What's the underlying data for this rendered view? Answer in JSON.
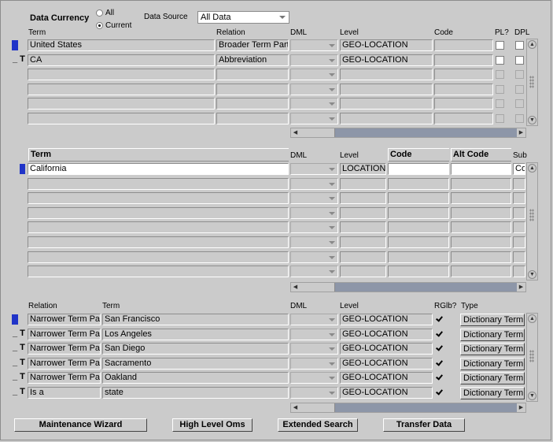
{
  "filters": {
    "data_currency_label": "Data Currency",
    "currency_all": "All",
    "currency_current": "Current",
    "data_source_label": "Data Source",
    "data_source_value": "All Data"
  },
  "block1": {
    "headers": {
      "term": "Term",
      "relation": "Relation",
      "dml": "DML",
      "level": "Level",
      "code": "Code",
      "pl": "PL?",
      "dpl": "DPL"
    },
    "rows": [
      {
        "flag": "",
        "term": "United States",
        "relation": "Broader Term Parti",
        "level": "GEO-LOCATION"
      },
      {
        "flag": "_ T",
        "term": "CA",
        "relation": "Abbreviation",
        "level": "GEO-LOCATION"
      }
    ]
  },
  "block2": {
    "headers": {
      "term": "Term",
      "dml": "DML",
      "level": "Level",
      "code": "Code",
      "alt_code": "Alt Code",
      "sub": "Sub"
    },
    "rows": [
      {
        "term": "California",
        "level": "LOCATION",
        "sub": "Co"
      }
    ]
  },
  "block3": {
    "headers": {
      "relation": "Relation",
      "term": "Term",
      "dml": "DML",
      "level": "Level",
      "rglb": "RGlb?",
      "type": "Type"
    },
    "rows": [
      {
        "flag": "",
        "relation": "Narrower Term Pa",
        "term": "San Francisco",
        "level": "GEO-LOCATION",
        "type": "Dictionary Term"
      },
      {
        "flag": "_ T",
        "relation": "Narrower Term Pa",
        "term": "Los Angeles",
        "level": "GEO-LOCATION",
        "type": "Dictionary Term"
      },
      {
        "flag": "_ T",
        "relation": "Narrower Term Pa",
        "term": "San Diego",
        "level": "GEO-LOCATION",
        "type": "Dictionary Term"
      },
      {
        "flag": "_ T",
        "relation": "Narrower Term Pa",
        "term": "Sacramento",
        "level": "GEO-LOCATION",
        "type": "Dictionary Term"
      },
      {
        "flag": "_ T",
        "relation": "Narrower Term Pa",
        "term": "Oakland",
        "level": "GEO-LOCATION",
        "type": "Dictionary Term"
      },
      {
        "flag": "_ T",
        "relation": "Is a",
        "term": "state",
        "level": "GEO-LOCATION",
        "type": "Dictionary Term"
      }
    ]
  },
  "buttons": {
    "maintenance_wizard": "Maintenance Wizard",
    "high_level_oms": "High Level Oms",
    "extended_search": "Extended Search",
    "transfer_data": "Transfer Data"
  },
  "colors": {
    "background": "#cbcbcb",
    "row_indicator": "#2034c8",
    "scroll_track": "#8d96a8"
  }
}
